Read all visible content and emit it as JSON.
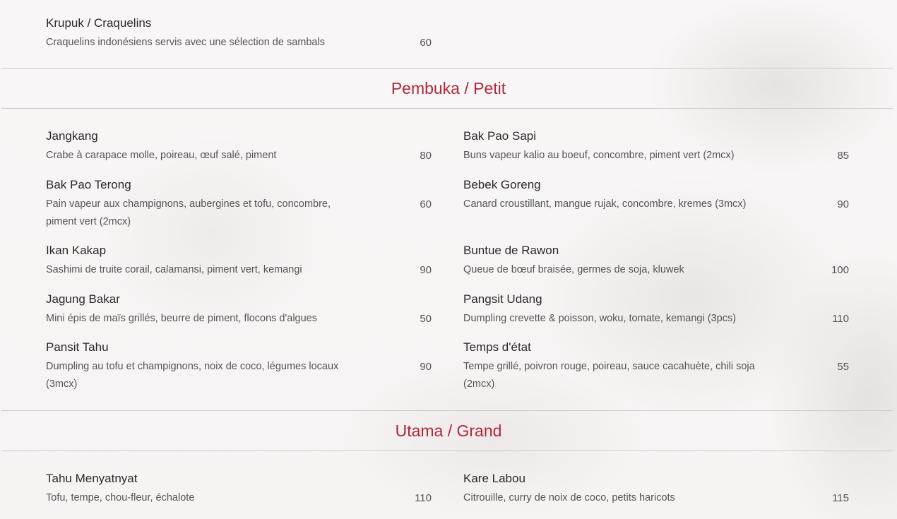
{
  "intro": {
    "name": "Krupuk / Craquelins",
    "desc": "Craquelins indonésiens servis avec une sélection de sambals",
    "price": "60"
  },
  "sections": [
    {
      "title": "Pembuka / Petit",
      "left": [
        {
          "name": "Jangkang",
          "desc": "Crabe à carapace molle, poireau, œuf salé, piment",
          "price": "80"
        },
        {
          "name": "Bak Pao Terong",
          "desc": "Pain vapeur aux champignons, aubergines et tofu, concombre, piment vert (2mcx)",
          "price": "60"
        },
        {
          "name": "Ikan Kakap",
          "desc": "Sashimi de truite corail, calamansi, piment vert, kemangi",
          "price": "90"
        },
        {
          "name": "Jagung Bakar",
          "desc": "Mini épis de maïs grillés, beurre de piment, flocons d'algues",
          "price": "50"
        },
        {
          "name": "Pansit Tahu",
          "desc": "Dumpling au tofu et champignons, noix de coco, légumes locaux (3mcx)",
          "price": "90"
        }
      ],
      "right": [
        {
          "name": "Bak Pao Sapi",
          "desc": "Buns vapeur kalio au boeuf, concombre, piment vert (2mcx)",
          "price": "85"
        },
        {
          "name": "Bebek Goreng",
          "desc": "Canard croustillant, mangue rujak, concombre, kremes (3mcx)",
          "price": "90"
        },
        {
          "name": "Buntue de Rawon",
          "desc": "Queue de bœuf braisée, germes de soja, kluwek",
          "price": "100"
        },
        {
          "name": "Pangsit Udang",
          "desc": "Dumpling crevette & poisson, woku, tomate, kemangi (3pcs)",
          "price": "110"
        },
        {
          "name": "Temps d'état",
          "desc": "Tempe grillé, poivron rouge, poireau, sauce cacahuète, chili soja (2mcx)",
          "price": "55"
        }
      ]
    },
    {
      "title": "Utama / Grand",
      "left": [
        {
          "name": "Tahu Menyatnyat",
          "desc": "Tofu, tempe, chou-fleur, échalote",
          "price": "110"
        }
      ],
      "right": [
        {
          "name": "Kare Labou",
          "desc": "Citrouille, curry de noix de coco, petits haricots",
          "price": "115"
        }
      ]
    }
  ],
  "colors": {
    "accent": "#b0283a",
    "divider": "#cfcaca",
    "text": "#2a2a2a",
    "muted": "#555555"
  }
}
